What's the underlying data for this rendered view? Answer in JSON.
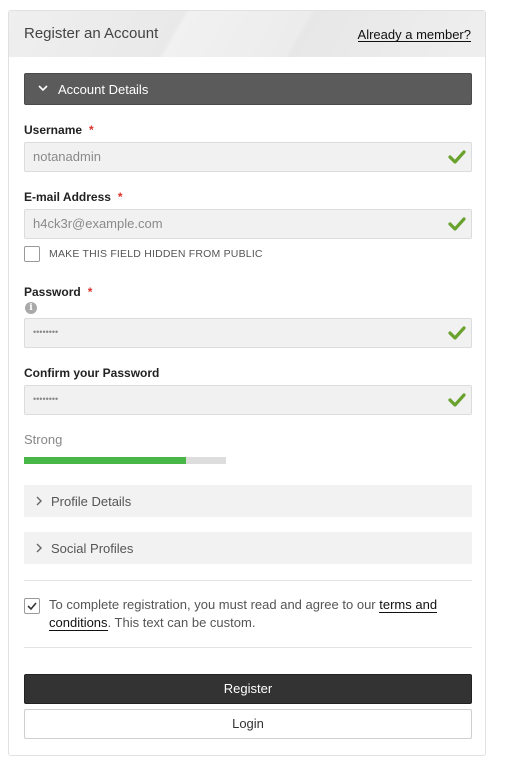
{
  "header": {
    "title": "Register an Account",
    "member_link": "Already a member?"
  },
  "account_section": {
    "label": "Account Details",
    "expanded": true
  },
  "fields": {
    "username": {
      "label": "Username",
      "required_mark": "*",
      "value": "notanadmin",
      "valid": true
    },
    "email": {
      "label": "E-mail Address",
      "required_mark": "*",
      "value": "h4ck3r@example.com",
      "valid": true
    },
    "hide_email": {
      "label": "MAKE THIS FIELD HIDDEN FROM PUBLIC",
      "checked": false
    },
    "password": {
      "label": "Password",
      "required_mark": "*",
      "value": "••••••••",
      "valid": true
    },
    "confirm_password": {
      "label": "Confirm your Password",
      "value": "••••••••",
      "valid": true
    }
  },
  "strength": {
    "label": "Strong",
    "level_percent": 80
  },
  "collapsed_sections": {
    "profile": {
      "label": "Profile Details"
    },
    "social": {
      "label": "Social Profiles"
    }
  },
  "terms": {
    "checked": true,
    "text_before": "To complete registration, you must read and agree to our ",
    "link_text": "terms and conditions",
    "text_after": ". This text can be custom."
  },
  "buttons": {
    "register": "Register",
    "login": "Login"
  },
  "colors": {
    "valid_check": "#6aa22e",
    "strength_fill": "#49b648",
    "required": "#d9322c",
    "primary_button": "#333333"
  }
}
